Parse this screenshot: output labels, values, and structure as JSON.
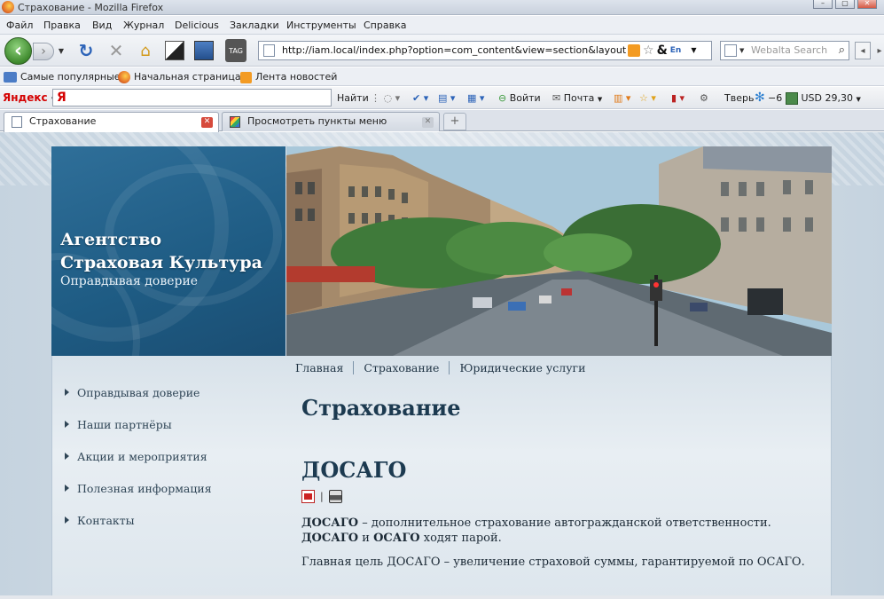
{
  "window": {
    "title": "Страхование - Mozilla Firefox"
  },
  "menu": [
    "Файл",
    "Правка",
    "Вид",
    "Журнал",
    "Delicious",
    "Закладки",
    "Инструменты",
    "Справка"
  ],
  "navbar": {
    "url": "http://iam.local/index.php?option=com_content&view=section&layout=blc",
    "search_placeholder": "Webalta Search"
  },
  "bookmarks": [
    "Самые популярные",
    "Начальная страница",
    "Лента новостей"
  ],
  "yandex": {
    "logo": "Яндекс",
    "input_text": "Я",
    "find": "Найти",
    "login": "Войти",
    "mail": "Почта",
    "city": "Тверь",
    "temp": "−6",
    "currency": "USD 29,30"
  },
  "tabs": [
    {
      "label": "Страхование",
      "active": true
    },
    {
      "label": "Просмотреть пункты меню",
      "active": false
    }
  ],
  "site": {
    "brand_line1": "Агентство",
    "brand_line2": "Страховая Культура",
    "slogan": "Оправдывая доверие",
    "topnav": [
      "Главная",
      "Страхование",
      "Юридические услуги"
    ],
    "sidemenu": [
      "Оправдывая доверие",
      "Наши партнёры",
      "Акции и мероприятия",
      "Полезная информация",
      "Контакты"
    ]
  },
  "article": {
    "section_title": "Страхование",
    "heading": "ДОСАГО",
    "p1_b1": "ДОСАГО",
    "p1_t1": " – дополнительное страхование автогражданской ответственности.",
    "p1_b2": "ДОСАГО",
    "p1_t2": " и ",
    "p1_b3": "ОСАГО",
    "p1_t3": " ходят парой.",
    "p2": "Главная цель ДОСАГО – увеличение страховой суммы, гарантируемой по ОСАГО."
  },
  "colors": {
    "brand_blue": "#1e5b83",
    "text_dark": "#1c3a50",
    "yandex_red": "#d40000"
  }
}
